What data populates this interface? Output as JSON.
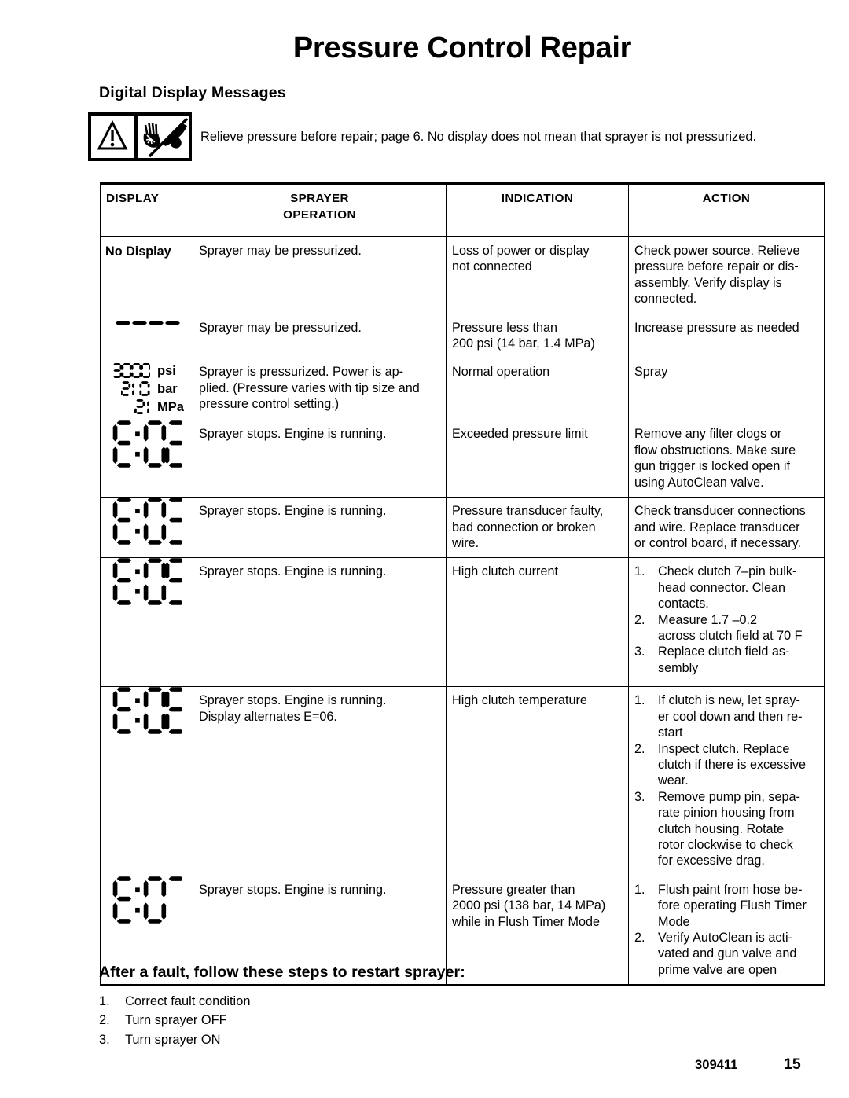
{
  "page": {
    "title": "Pressure Control Repair",
    "section_heading": "Digital Display Messages",
    "warning": {
      "icon_1": "warning-triangle-icon",
      "icon_2": "skin-injection-hazard-icon",
      "text": "Relieve pressure before repair; page 6. No display does not mean that sprayer is not pressurized."
    },
    "footer": {
      "part_number": "309411",
      "page_number": "15"
    }
  },
  "table": {
    "headers": {
      "display": "DISPLAY",
      "sprayer_operation_line1": "SPRAYER",
      "sprayer_operation_line2": "OPERATION",
      "indication": "INDICATION",
      "action": "ACTION"
    },
    "rows": [
      {
        "display_kind": "text",
        "display_text": "No Display",
        "sprayer_operation": [
          "Sprayer may be pressurized."
        ],
        "indication": [
          "Loss of power or display",
          "not connected"
        ],
        "action_kind": "paragraph",
        "action": [
          "Check power source. Relieve",
          "pressure before repair or dis-",
          "assembly. Verify display is",
          "connected."
        ]
      },
      {
        "display_kind": "dashes",
        "display_text": "- - - -",
        "sprayer_operation": [
          "Sprayer may be pressurized."
        ],
        "indication": [
          "Pressure less than",
          "200 psi (14 bar, 1.4 MPa)"
        ],
        "action_kind": "paragraph",
        "action": [
          "Increase pressure as needed"
        ]
      },
      {
        "display_kind": "units",
        "units": [
          {
            "value": "3000",
            "label": "psi"
          },
          {
            "value": "210",
            "label": "bar"
          },
          {
            "value": "21",
            "label": "MPa"
          }
        ],
        "sprayer_operation": [
          "Sprayer is pressurized. Power is ap-",
          "plied. (Pressure varies with tip size and",
          "pressure control setting.)"
        ],
        "indication": [
          "Normal operation"
        ],
        "action_kind": "paragraph",
        "action": [
          "Spray"
        ]
      },
      {
        "display_kind": "code",
        "display_text": "E:02",
        "sprayer_operation": [
          "Sprayer stops. Engine is running."
        ],
        "indication": [
          "Exceeded pressure limit"
        ],
        "action_kind": "paragraph",
        "action": [
          "Remove any filter clogs or",
          "flow obstructions. Make sure",
          "gun trigger is locked open if",
          "using AutoClean valve."
        ]
      },
      {
        "display_kind": "code",
        "display_text": "E:03",
        "sprayer_operation": [
          "Sprayer stops. Engine is running."
        ],
        "indication": [
          "Pressure transducer faulty,",
          "bad connection or broken",
          "wire."
        ],
        "action_kind": "paragraph",
        "action": [
          "Check transducer connections",
          "and wire. Replace transducer",
          "or control board, if necessary."
        ]
      },
      {
        "display_kind": "code",
        "display_text": "E:05",
        "sprayer_operation": [
          "Sprayer stops. Engine is running."
        ],
        "indication": [
          "High clutch current"
        ],
        "action_kind": "list",
        "action_steps": [
          {
            "num": "1.",
            "lines": [
              "Check clutch 7–pin bulk-",
              "head connector. Clean",
              "contacts."
            ]
          },
          {
            "num": "2.",
            "lines": [
              "Measure 1.7  –0.2",
              "across clutch field at 70  F"
            ]
          },
          {
            "num": "3.",
            "lines": [
              "Replace clutch field as-",
              "sembly"
            ]
          }
        ]
      },
      {
        "display_kind": "code",
        "display_text": "E:06",
        "sprayer_operation": [
          "Sprayer stops. Engine is running.",
          "Display alternates  E=06."
        ],
        "indication": [
          "High clutch temperature"
        ],
        "action_kind": "list",
        "action_steps": [
          {
            "num": "1.",
            "lines": [
              "If clutch is new, let spray-",
              "er cool down and then re-",
              "start"
            ]
          },
          {
            "num": "2.",
            "lines": [
              "Inspect clutch. Replace",
              "clutch if there is excessive",
              "wear."
            ]
          },
          {
            "num": "3.",
            "lines": [
              "Remove pump pin, sepa-",
              "rate pinion housing from",
              "clutch housing. Rotate",
              "rotor clockwise to check",
              "for excessive drag."
            ]
          }
        ]
      },
      {
        "display_kind": "code",
        "display_text": "E:07",
        "sprayer_operation": [
          "Sprayer stops. Engine is running."
        ],
        "indication": [
          "Pressure greater than",
          "2000 psi (138 bar, 14 MPa)",
          "while in Flush Timer Mode"
        ],
        "action_kind": "list",
        "action_steps": [
          {
            "num": "1.",
            "lines": [
              "Flush paint from hose be-",
              "fore operating Flush Timer",
              "Mode"
            ]
          },
          {
            "num": "2.",
            "lines": [
              "Verify AutoClean is acti-",
              "vated and gun valve and",
              "prime valve are open"
            ]
          }
        ]
      }
    ]
  },
  "restart": {
    "heading": "After a fault, follow these steps to restart sprayer:",
    "steps": [
      {
        "num": "1.",
        "text": "Correct fault condition"
      },
      {
        "num": "2.",
        "text": "Turn sprayer OFF"
      },
      {
        "num": "3.",
        "text": "Turn sprayer ON"
      }
    ]
  }
}
